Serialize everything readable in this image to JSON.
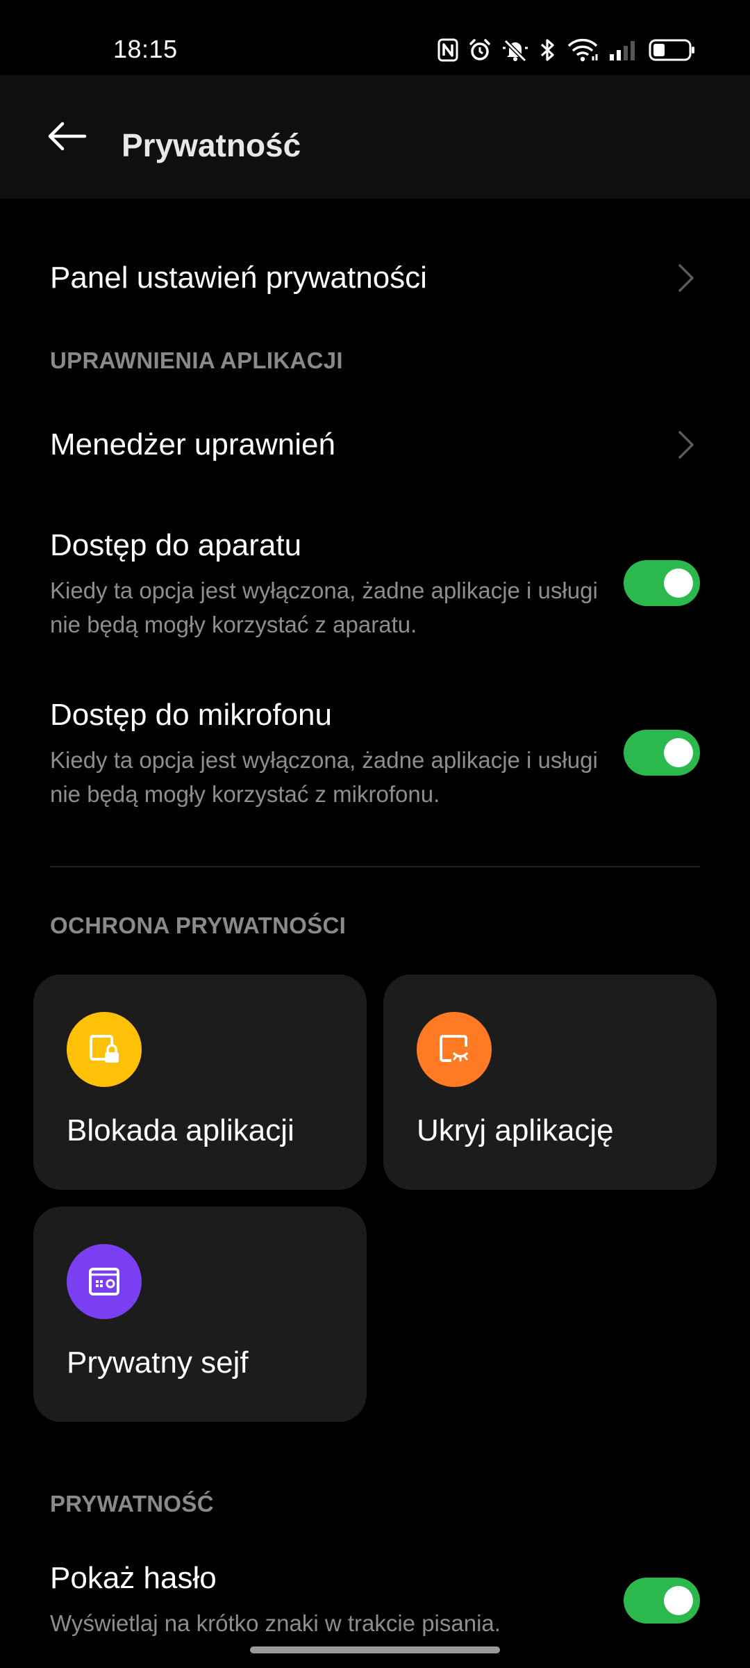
{
  "status_bar": {
    "time": "18:15",
    "icons": [
      "nfc-icon",
      "alarm-icon",
      "mute-icon",
      "bluetooth-icon",
      "wifi-icon",
      "signal-icon",
      "battery-icon"
    ]
  },
  "app_bar": {
    "title": "Prywatność"
  },
  "privacy_panel": {
    "label": "Panel ustawień prywatności"
  },
  "app_permissions": {
    "header": "UPRAWNIENIA APLIKACJI",
    "manager_label": "Menedżer uprawnień",
    "camera": {
      "title": "Dostęp do aparatu",
      "description": "Kiedy ta opcja jest wyłączona, żadne aplikacje i usługi nie będą mogły korzystać z aparatu.",
      "enabled": true
    },
    "microphone": {
      "title": "Dostęp do mikrofonu",
      "description": "Kiedy ta opcja jest wyłączona, żadne aplikacje i usługi nie będą mogły korzystać z mikrofonu.",
      "enabled": true
    }
  },
  "privacy_protection": {
    "header": "OCHRONA PRYWATNOŚCI",
    "cards": [
      {
        "label": "Blokada aplikacji",
        "icon": "app-lock-icon",
        "color": "#ffc107"
      },
      {
        "label": "Ukryj aplikację",
        "icon": "hide-app-icon",
        "color": "#ff7a22"
      },
      {
        "label": "Prywatny sejf",
        "icon": "safe-icon",
        "color": "#7a3ff0"
      }
    ]
  },
  "privacy": {
    "header": "PRYWATNOŚĆ",
    "show_password": {
      "title": "Pokaż hasło",
      "description": "Wyświetlaj na krótko znaki w trakcie pisania.",
      "enabled": true
    }
  },
  "colors": {
    "toggle_on": "#2bb94d",
    "card_bg": "#1c1c1c",
    "section_header": "#8a8a8a"
  }
}
